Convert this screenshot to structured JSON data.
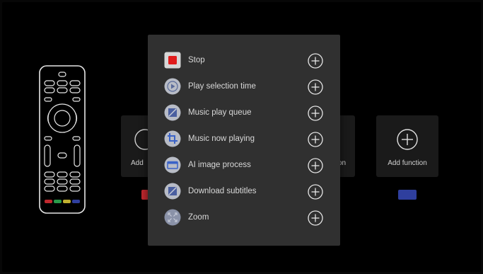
{
  "background_cards": {
    "left_label": "Add",
    "center_label": "on",
    "right_label": "Add function"
  },
  "colors": {
    "left_key": "#c0282e",
    "right_key": "#2f3f9e",
    "remote_keys": [
      "#c0282e",
      "#2a9a4a",
      "#c0b030",
      "#2f3f9e"
    ]
  },
  "popup": {
    "items": [
      {
        "label": "Stop",
        "icon": "stop-icon"
      },
      {
        "label": "Play selection time",
        "icon": "play-selection-time-icon"
      },
      {
        "label": "Music play queue",
        "icon": "music-play-queue-icon"
      },
      {
        "label": "Music now playing",
        "icon": "music-now-playing-icon"
      },
      {
        "label": "AI image process",
        "icon": "ai-image-process-icon"
      },
      {
        "label": "Download subtitles",
        "icon": "download-subtitles-icon"
      },
      {
        "label": "Zoom",
        "icon": "zoom-icon"
      }
    ]
  }
}
